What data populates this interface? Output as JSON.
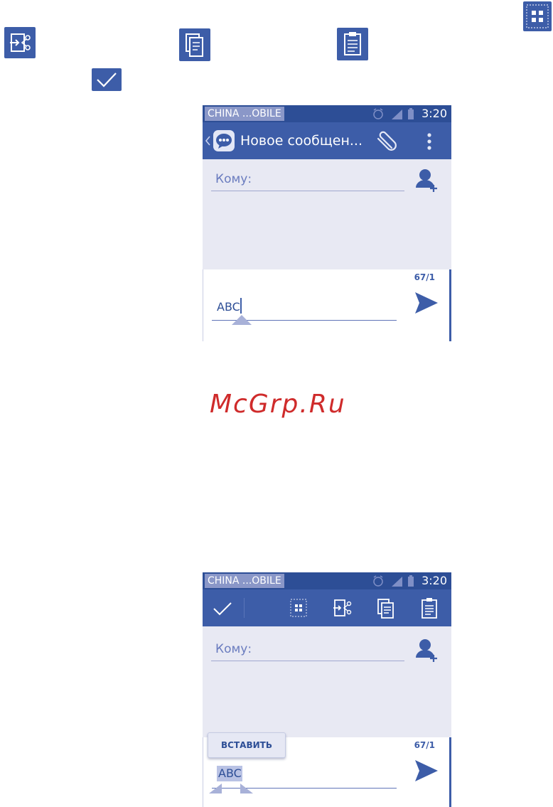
{
  "icon_legend": {
    "select_all_icon": "select-all-icon",
    "cut_icon": "cut-icon",
    "copy_icon": "copy-icon",
    "paste_icon": "paste-icon",
    "done_icon": "checkmark-icon"
  },
  "screen1": {
    "carrier": "CHINA ...OBILE",
    "time": "3:20",
    "title": "Новое сообщен...",
    "to_placeholder": "Кому:",
    "counter": "67/1",
    "message_text": "ABC"
  },
  "watermark": "McGrp.Ru",
  "screen2": {
    "carrier": "CHINA ...OBILE",
    "time": "3:20",
    "to_placeholder": "Кому:",
    "counter": "67/1",
    "paste_label": "ВСТАВИТЬ",
    "message_text": "ABC"
  },
  "colors": {
    "statusbar": "#2d4e96",
    "appbar": "#3d5da8",
    "background": "#e8e9f3",
    "accent": "#6a7cbf",
    "watermark": "#cf2b2b"
  }
}
